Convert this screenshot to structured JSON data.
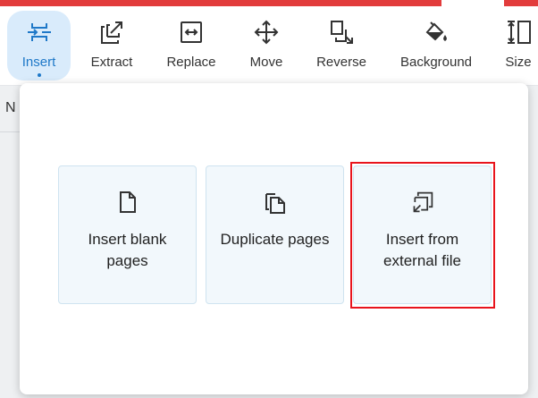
{
  "toolbar": {
    "items": [
      {
        "label": "Insert",
        "icon": "insert-icon",
        "active": true
      },
      {
        "label": "Extract",
        "icon": "extract-icon"
      },
      {
        "label": "Replace",
        "icon": "replace-icon"
      },
      {
        "label": "Move",
        "icon": "move-icon"
      },
      {
        "label": "Reverse",
        "icon": "reverse-icon"
      },
      {
        "label": "Background",
        "icon": "background-icon"
      },
      {
        "label": "Size",
        "icon": "size-icon"
      }
    ]
  },
  "background": {
    "fragment_text": "N"
  },
  "insert_menu": {
    "options": [
      {
        "label": "Insert blank pages",
        "icon": "blank-page-icon"
      },
      {
        "label": "Duplicate pages",
        "icon": "duplicate-pages-icon"
      },
      {
        "label": "Insert from external file",
        "icon": "external-file-icon",
        "highlighted": true
      }
    ]
  },
  "colors": {
    "accent": "#1e78c8",
    "active_bg": "#d9ebfb",
    "card_bg": "#f2f8fc",
    "highlight": "#e8141c",
    "top_strip": "#e23c3c"
  }
}
